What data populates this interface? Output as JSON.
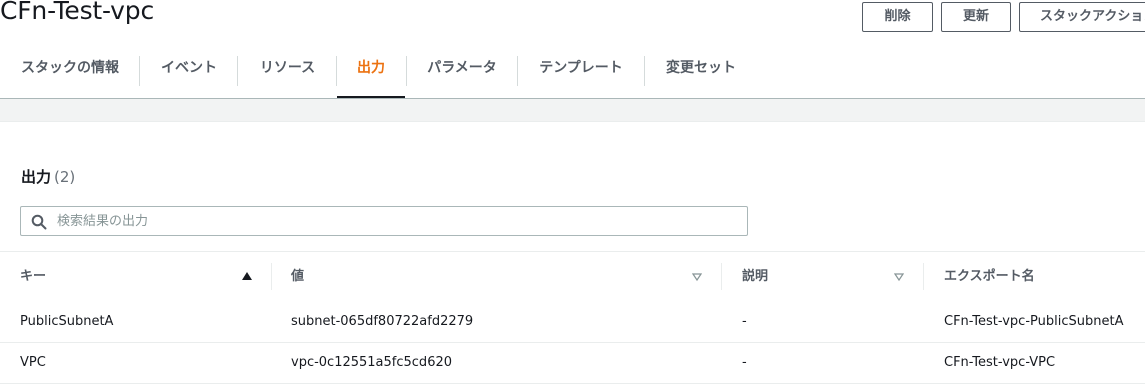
{
  "stack": {
    "title": "CFn-Test-vpc"
  },
  "actions": {
    "delete_label": "削除",
    "update_label": "更新",
    "stack_actions_label": "スタックアクション"
  },
  "tabs": [
    {
      "label": "スタックの情報"
    },
    {
      "label": "イベント"
    },
    {
      "label": "リソース"
    },
    {
      "label": "出力",
      "active": true
    },
    {
      "label": "パラメータ"
    },
    {
      "label": "テンプレート"
    },
    {
      "label": "変更セット"
    }
  ],
  "outputs": {
    "heading": "出力",
    "count": "(2)",
    "search": {
      "placeholder": "検索結果の出力",
      "value": ""
    },
    "columns": [
      {
        "label": "キー",
        "sort": "ascending"
      },
      {
        "label": "値",
        "sort": "none"
      },
      {
        "label": "説明",
        "sort": "none"
      },
      {
        "label": "エクスポート名"
      }
    ],
    "rows": [
      {
        "key": "PublicSubnetA",
        "value": "subnet-065df80722afd2279",
        "description": "-",
        "export_name": "CFn-Test-vpc-PublicSubnetA"
      },
      {
        "key": "VPC",
        "value": "vpc-0c12551a5fc5cd620",
        "description": "-",
        "export_name": "CFn-Test-vpc-VPC"
      }
    ]
  },
  "colors": {
    "active_tab": "#ec7211",
    "text": "#16191f",
    "muted": "#545b64",
    "border": "#aab7b8",
    "panel_bg": "#f2f3f3"
  }
}
